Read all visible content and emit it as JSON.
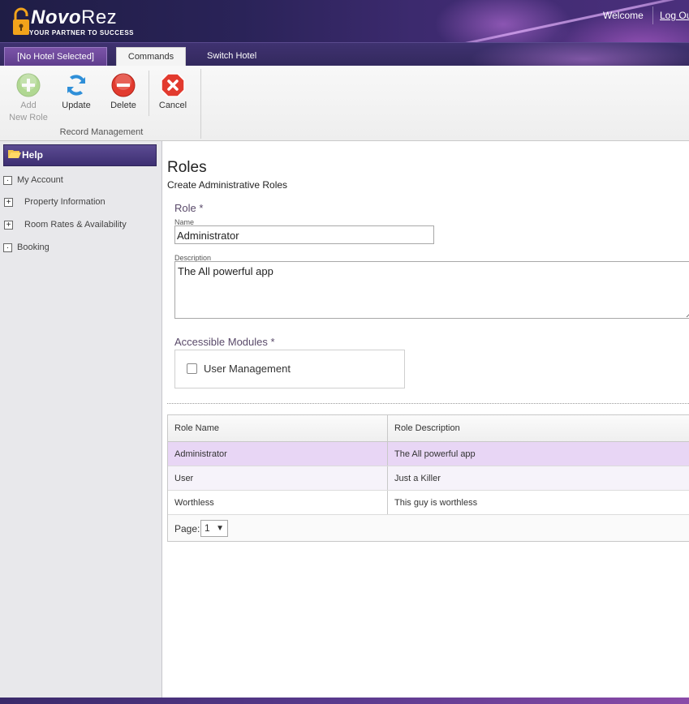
{
  "header": {
    "brand_bold": "Novo",
    "brand_light": "Rez",
    "tagline": "YOUR PARTNER TO SUCCESS",
    "welcome": "Welcome",
    "logout": "Log Out"
  },
  "tabs": {
    "hotel": "[No Hotel Selected]",
    "commands": "Commands",
    "switch_hotel": "Switch Hotel"
  },
  "ribbon": {
    "add_line1": "Add",
    "add_line2": "New Role",
    "update": "Update",
    "delete": "Delete",
    "cancel": "Cancel",
    "group_label": "Record Management"
  },
  "sidebar": {
    "help": "Help",
    "items": [
      {
        "label": "My Account",
        "toggle": "·"
      },
      {
        "label": "Property Information",
        "toggle": "+"
      },
      {
        "label": "Room Rates & Availability",
        "toggle": "+"
      },
      {
        "label": "Booking",
        "toggle": "·"
      }
    ]
  },
  "page": {
    "title": "Roles",
    "subtitle": "Create Administrative Roles"
  },
  "form": {
    "role_section": "Role *",
    "name_label": "Name",
    "name_value": "Administrator",
    "description_label": "Description",
    "description_value": "The All powerful app",
    "modules_section": "Accessible Modules *",
    "modules": [
      {
        "label": "User Management",
        "checked": false
      }
    ]
  },
  "grid": {
    "columns": [
      "Role Name",
      "Role Description"
    ],
    "rows": [
      [
        "Administrator",
        "The All powerful app"
      ],
      [
        "User",
        "Just a Killer"
      ],
      [
        "Worthless",
        "This guy is worthless"
      ]
    ],
    "page_label": "Page:",
    "page_value": "1",
    "page_arrow": "▼"
  },
  "colors": {
    "accent": "#3d2f72",
    "selected_row": "#e8d6f5",
    "add_icon": "#7ac143",
    "update_icon": "#2f8fd8",
    "delete_icon": "#e23a2e"
  }
}
